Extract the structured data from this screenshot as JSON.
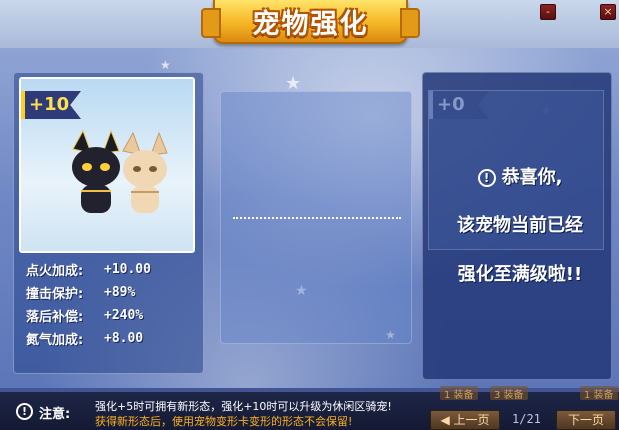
{
  "title": "宠物强化",
  "window": {
    "minimize": "-",
    "close": "×"
  },
  "left_card": {
    "level": "+10",
    "stats": [
      {
        "label": "点火加成:",
        "value": "+10.00"
      },
      {
        "label": "撞击保护:",
        "value": "+89%"
      },
      {
        "label": "落后补偿:",
        "value": "+240%"
      },
      {
        "label": "氮气加成:",
        "value": "+8.00"
      }
    ]
  },
  "right_card": {
    "level": "+0",
    "message": [
      "恭喜你,",
      "该宠物当前已经",
      "强化至满级啦!!"
    ]
  },
  "notice": {
    "label": "注意:",
    "line1": "强化+5时可拥有新形态，强化+10时可以升级为休闲区骑宠!",
    "line2": "获得新形态后，使用宠物变形卡变形的形态不会保留!",
    "line1_color": "#ffffff",
    "line2_color": "#ffb020"
  },
  "pager": {
    "prev": "◀ 上一页",
    "page": "1/21",
    "next": "下一页",
    "tab1": "1 装备",
    "tab2": "3 装备",
    "tab3": "1 装备"
  },
  "colors": {
    "accent": "#f6b624",
    "dialog": "#6f87c4",
    "level": "#ffe14d"
  },
  "icons": [
    "warning-icon",
    "info-icon",
    "star-icon",
    "cat-pet-icon"
  ]
}
